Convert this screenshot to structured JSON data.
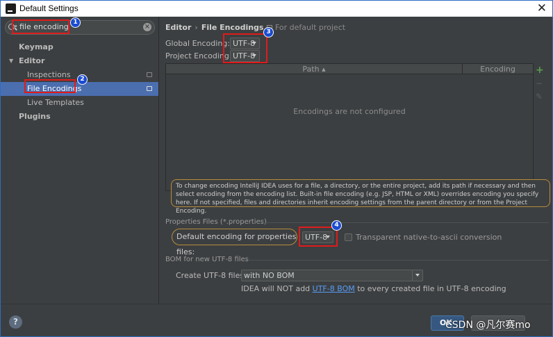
{
  "window": {
    "title": "Default Settings",
    "close_glyph": "✕",
    "icon": "intellij-idea-icon"
  },
  "search": {
    "value": "file encoding",
    "clear_glyph": "×",
    "icon": "search-icon"
  },
  "sidebar": {
    "items": [
      {
        "label": "Keymap"
      },
      {
        "label": "Editor"
      },
      {
        "label": "Inspections"
      },
      {
        "label": "File Encodings"
      },
      {
        "label": "Live Templates"
      },
      {
        "label": "Plugins"
      }
    ]
  },
  "breadcrumb": {
    "part1": "Editor",
    "sep": "›",
    "part2": "File Encodings",
    "project_note": "For default project"
  },
  "encodings": {
    "global_label": "Global Encoding:",
    "global_value": "UTF-8",
    "project_label": "Project Encoding:",
    "project_value": "UTF-8"
  },
  "table": {
    "col_path": "Path ▴",
    "col_encoding": "Encoding",
    "empty_text": "Encodings are not configured",
    "add_glyph": "+",
    "remove_glyph": "−",
    "edit_glyph": "✎"
  },
  "info": {
    "text": "To change encoding IntelliJ IDEA uses for a file, a directory, or the entire project, add its path if necessary and then select encoding from the encoding list. Built-in file encoding (e.g. JSP, HTML or XML) overrides encoding you specify here. If not specified, files and directories inherit encoding settings from the parent directory or from the Project Encoding."
  },
  "properties": {
    "group_label": "Properties Files (*.properties)",
    "default_label": "Default encoding for properties files:",
    "default_value": "UTF-8",
    "transparent_label": "Transparent native-to-ascii conversion"
  },
  "bom": {
    "group_label": "BOM for new UTF-8 files",
    "create_label": "Create UTF-8 files:",
    "create_value": "with NO BOM",
    "note_before": "IDEA will NOT add ",
    "note_link": "UTF-8 BOM",
    "note_after": " to every created file in UTF-8 encoding"
  },
  "annotations": {
    "b1": "1",
    "b2": "2",
    "b3": "3",
    "b4": "4"
  },
  "buttons": {
    "ok": "OK",
    "help": "?"
  },
  "watermark": "CSDN @凡尔赛mo",
  "colors": {
    "selection": "#4b6eaf",
    "annotation_red": "#e01b1b",
    "badge_blue": "#1a4bd1",
    "info_border": "#b98b3a",
    "link": "#589df6"
  }
}
